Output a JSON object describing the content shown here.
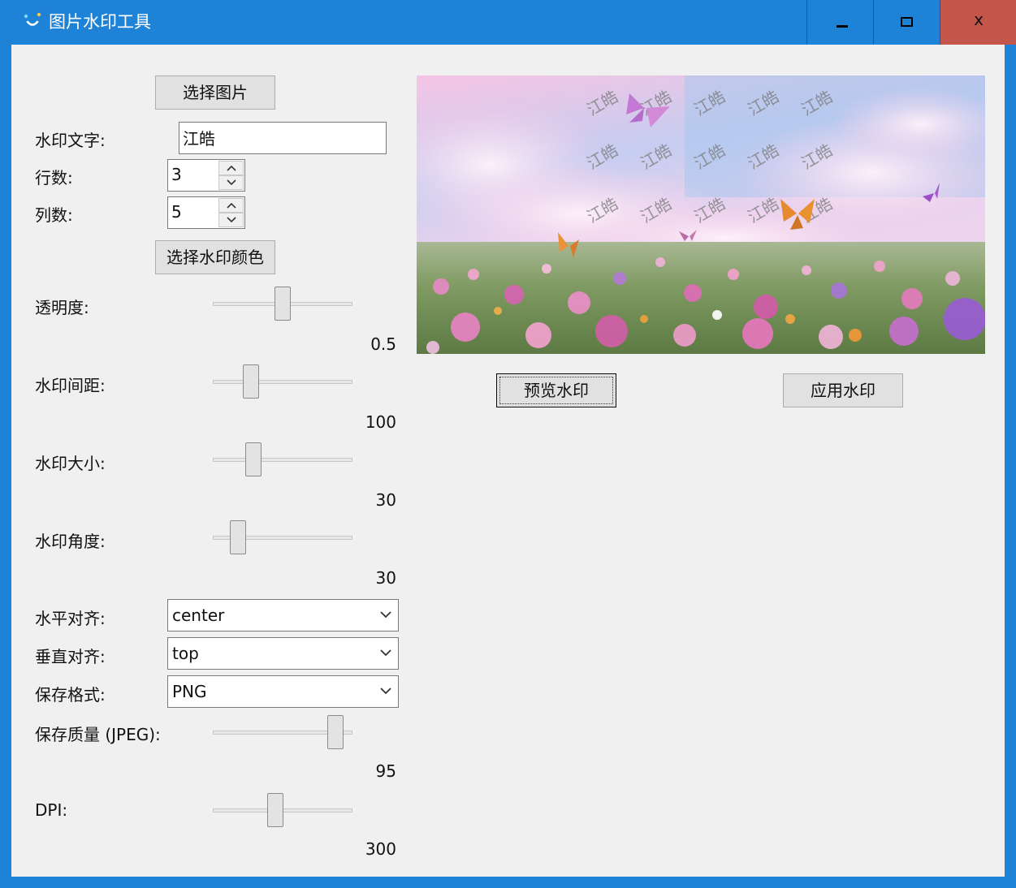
{
  "window": {
    "title": "图片水印工具",
    "close_glyph": "x"
  },
  "left": {
    "select_image_label": "选择图片",
    "watermark_text_label": "水印文字:",
    "watermark_text_value": "江皓",
    "rows_label": "行数:",
    "rows_value": "3",
    "cols_label": "列数:",
    "cols_value": "5",
    "select_color_label": "选择水印颜色",
    "opacity_label": "透明度:",
    "opacity_value": "0.5",
    "spacing_label": "水印间距:",
    "spacing_value": "100",
    "size_label": "水印大小:",
    "size_value": "30",
    "angle_label": "水印角度:",
    "angle_value": "30",
    "halign_label": "水平对齐:",
    "halign_value": "center",
    "valign_label": "垂直对齐:",
    "valign_value": "top",
    "format_label": "保存格式:",
    "format_value": "PNG",
    "quality_label": "保存质量 (JPEG):",
    "quality_value": "95",
    "dpi_label": "DPI:",
    "dpi_value": "300"
  },
  "sliders": {
    "opacity": {
      "min": 0,
      "max": 1,
      "value": 0.5
    },
    "spacing": {
      "value_fraction": 0.23
    },
    "size": {
      "value_fraction": 0.25
    },
    "angle": {
      "value_fraction": 0.12
    },
    "quality": {
      "value_fraction": 0.95
    },
    "dpi": {
      "value_fraction": 0.44
    }
  },
  "right": {
    "preview_watermark_text": "江皓",
    "preview_button_label": "预览水印",
    "apply_button_label": "应用水印"
  },
  "icons": {
    "app": "app-logo-icon",
    "minimize": "minimize-icon",
    "maximize": "maximize-icon",
    "close": "close-icon",
    "dropdown": "chevron-down-icon",
    "spin_up": "chevron-up-icon",
    "spin_down": "chevron-down-icon"
  },
  "colors": {
    "titlebar": "#1e83d6",
    "close_button": "#c4554b",
    "client_bg": "#f0f0f0",
    "watermark_text": "#7a7a7a"
  }
}
